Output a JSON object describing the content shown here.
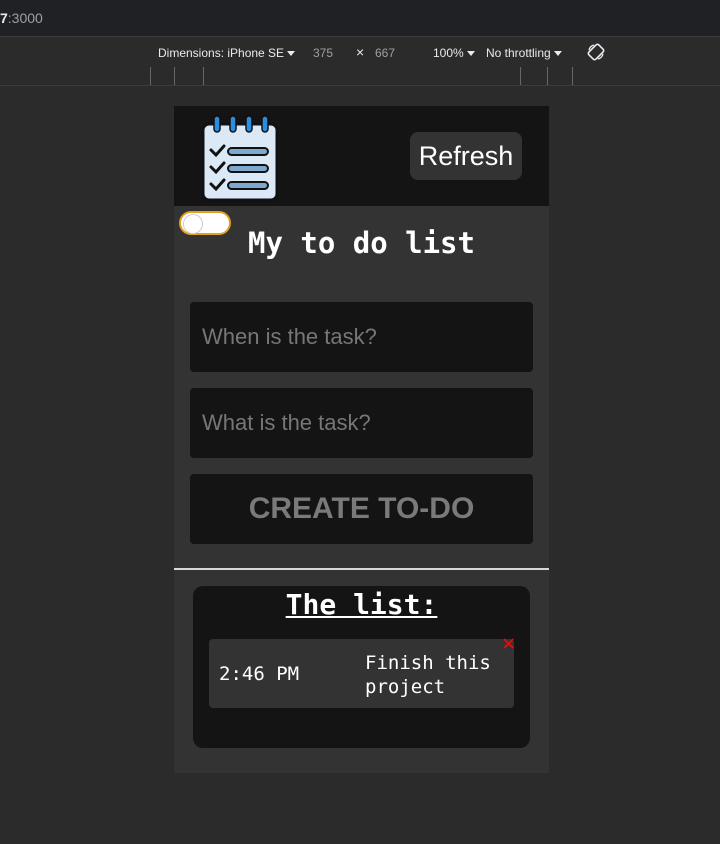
{
  "browser": {
    "url_host": "7",
    "url_rest": ":3000"
  },
  "device_toolbar": {
    "dimensions_label": "Dimensions: iPhone SE",
    "width": "375",
    "times": "×",
    "height": "667",
    "zoom": "100%",
    "throttling": "No throttling"
  },
  "app": {
    "refresh_label": "Refresh",
    "title": "My to do list",
    "when_placeholder": "When is the task?",
    "what_placeholder": "What is the task?",
    "create_label": "CREATE TO-DO",
    "list_title": "The list:",
    "todos": [
      {
        "time": "2:46 PM",
        "text": "Finish this project"
      }
    ],
    "delete_glyph": "✕"
  },
  "colors": {
    "accent_toggle": "#e0a020",
    "delete": "#e01010"
  }
}
